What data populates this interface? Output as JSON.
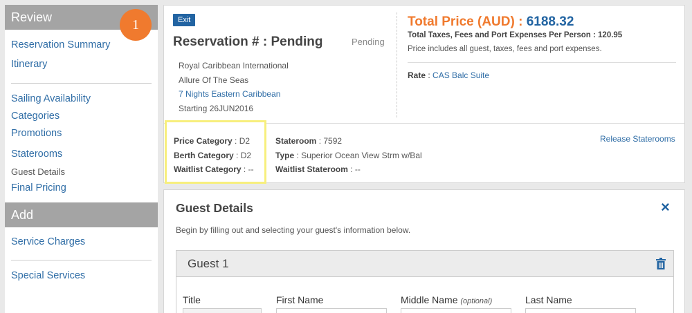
{
  "sidebar": {
    "review_header": "Review",
    "step_badge": "1",
    "review_items": [
      {
        "label": "Reservation Summary"
      },
      {
        "label": "Itinerary"
      }
    ],
    "booking_items": [
      {
        "label": "Sailing Availability"
      },
      {
        "label": "Categories"
      },
      {
        "label": "Promotions"
      },
      {
        "label": "Staterooms"
      },
      {
        "label": "Guest Details"
      },
      {
        "label": "Final Pricing"
      }
    ],
    "add_header": "Add",
    "add_items": [
      {
        "label": "Service Charges"
      },
      {
        "label": "Special Services"
      }
    ]
  },
  "reservation": {
    "exit_label": "Exit",
    "title": "Reservation # : Pending",
    "status": "Pending",
    "cruise_line": "Royal Caribbean International",
    "ship": "Allure Of The Seas",
    "itinerary": "7 Nights Eastern Caribbean",
    "start": "Starting 26JUN2016"
  },
  "pricing": {
    "total_label": "Total Price (AUD) :",
    "total_value": "6188.32",
    "taxes": "Total Taxes, Fees and Port Expenses Per Person : 120.95",
    "includes": "Price includes all guest, taxes, fees and port expenses.",
    "rate_label": "Rate",
    "rate_value": "CAS Balc Suite"
  },
  "categories": {
    "price_label": "Price Category",
    "price_value": ": D2",
    "berth_label": "Berth Category",
    "berth_value": ": D2",
    "waitlist_label": "Waitlist Category",
    "waitlist_value": ": --"
  },
  "stateroom": {
    "number_label": "Stateroom",
    "number_value": ": 7592",
    "type_label": "Type",
    "type_value": ": Superior Ocean View Strm w/Bal",
    "waitlist_label": "Waitlist Stateroom",
    "waitlist_value": ": --",
    "release_label": "Release Staterooms"
  },
  "guest_details": {
    "title": "Guest Details",
    "close_icon": "×",
    "subtitle": "Begin by filling out and selecting your guest's information below.",
    "guest_title": "Guest 1",
    "fields": {
      "title_label": "Title",
      "first_label": "First Name",
      "middle_label": "Middle Name",
      "middle_optional": "(optional)",
      "last_label": "Last Name"
    }
  }
}
